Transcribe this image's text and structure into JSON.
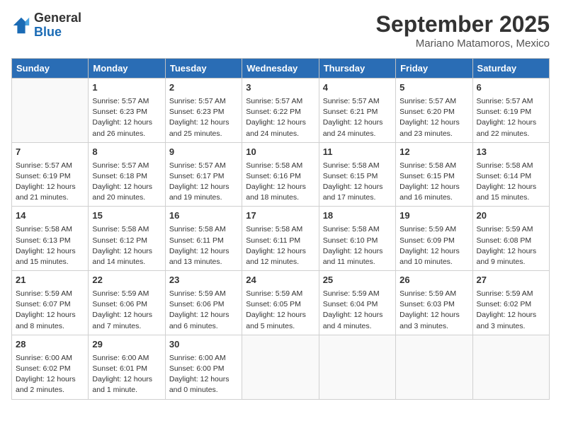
{
  "header": {
    "logo_line1": "General",
    "logo_line2": "Blue",
    "month": "September 2025",
    "location": "Mariano Matamoros, Mexico"
  },
  "days_of_week": [
    "Sunday",
    "Monday",
    "Tuesday",
    "Wednesday",
    "Thursday",
    "Friday",
    "Saturday"
  ],
  "weeks": [
    [
      {
        "num": "",
        "info": ""
      },
      {
        "num": "1",
        "info": "Sunrise: 5:57 AM\nSunset: 6:23 PM\nDaylight: 12 hours\nand 26 minutes."
      },
      {
        "num": "2",
        "info": "Sunrise: 5:57 AM\nSunset: 6:23 PM\nDaylight: 12 hours\nand 25 minutes."
      },
      {
        "num": "3",
        "info": "Sunrise: 5:57 AM\nSunset: 6:22 PM\nDaylight: 12 hours\nand 24 minutes."
      },
      {
        "num": "4",
        "info": "Sunrise: 5:57 AM\nSunset: 6:21 PM\nDaylight: 12 hours\nand 24 minutes."
      },
      {
        "num": "5",
        "info": "Sunrise: 5:57 AM\nSunset: 6:20 PM\nDaylight: 12 hours\nand 23 minutes."
      },
      {
        "num": "6",
        "info": "Sunrise: 5:57 AM\nSunset: 6:19 PM\nDaylight: 12 hours\nand 22 minutes."
      }
    ],
    [
      {
        "num": "7",
        "info": "Sunrise: 5:57 AM\nSunset: 6:19 PM\nDaylight: 12 hours\nand 21 minutes."
      },
      {
        "num": "8",
        "info": "Sunrise: 5:57 AM\nSunset: 6:18 PM\nDaylight: 12 hours\nand 20 minutes."
      },
      {
        "num": "9",
        "info": "Sunrise: 5:57 AM\nSunset: 6:17 PM\nDaylight: 12 hours\nand 19 minutes."
      },
      {
        "num": "10",
        "info": "Sunrise: 5:58 AM\nSunset: 6:16 PM\nDaylight: 12 hours\nand 18 minutes."
      },
      {
        "num": "11",
        "info": "Sunrise: 5:58 AM\nSunset: 6:15 PM\nDaylight: 12 hours\nand 17 minutes."
      },
      {
        "num": "12",
        "info": "Sunrise: 5:58 AM\nSunset: 6:15 PM\nDaylight: 12 hours\nand 16 minutes."
      },
      {
        "num": "13",
        "info": "Sunrise: 5:58 AM\nSunset: 6:14 PM\nDaylight: 12 hours\nand 15 minutes."
      }
    ],
    [
      {
        "num": "14",
        "info": "Sunrise: 5:58 AM\nSunset: 6:13 PM\nDaylight: 12 hours\nand 15 minutes."
      },
      {
        "num": "15",
        "info": "Sunrise: 5:58 AM\nSunset: 6:12 PM\nDaylight: 12 hours\nand 14 minutes."
      },
      {
        "num": "16",
        "info": "Sunrise: 5:58 AM\nSunset: 6:11 PM\nDaylight: 12 hours\nand 13 minutes."
      },
      {
        "num": "17",
        "info": "Sunrise: 5:58 AM\nSunset: 6:11 PM\nDaylight: 12 hours\nand 12 minutes."
      },
      {
        "num": "18",
        "info": "Sunrise: 5:58 AM\nSunset: 6:10 PM\nDaylight: 12 hours\nand 11 minutes."
      },
      {
        "num": "19",
        "info": "Sunrise: 5:59 AM\nSunset: 6:09 PM\nDaylight: 12 hours\nand 10 minutes."
      },
      {
        "num": "20",
        "info": "Sunrise: 5:59 AM\nSunset: 6:08 PM\nDaylight: 12 hours\nand 9 minutes."
      }
    ],
    [
      {
        "num": "21",
        "info": "Sunrise: 5:59 AM\nSunset: 6:07 PM\nDaylight: 12 hours\nand 8 minutes."
      },
      {
        "num": "22",
        "info": "Sunrise: 5:59 AM\nSunset: 6:06 PM\nDaylight: 12 hours\nand 7 minutes."
      },
      {
        "num": "23",
        "info": "Sunrise: 5:59 AM\nSunset: 6:06 PM\nDaylight: 12 hours\nand 6 minutes."
      },
      {
        "num": "24",
        "info": "Sunrise: 5:59 AM\nSunset: 6:05 PM\nDaylight: 12 hours\nand 5 minutes."
      },
      {
        "num": "25",
        "info": "Sunrise: 5:59 AM\nSunset: 6:04 PM\nDaylight: 12 hours\nand 4 minutes."
      },
      {
        "num": "26",
        "info": "Sunrise: 5:59 AM\nSunset: 6:03 PM\nDaylight: 12 hours\nand 3 minutes."
      },
      {
        "num": "27",
        "info": "Sunrise: 5:59 AM\nSunset: 6:02 PM\nDaylight: 12 hours\nand 3 minutes."
      }
    ],
    [
      {
        "num": "28",
        "info": "Sunrise: 6:00 AM\nSunset: 6:02 PM\nDaylight: 12 hours\nand 2 minutes."
      },
      {
        "num": "29",
        "info": "Sunrise: 6:00 AM\nSunset: 6:01 PM\nDaylight: 12 hours\nand 1 minute."
      },
      {
        "num": "30",
        "info": "Sunrise: 6:00 AM\nSunset: 6:00 PM\nDaylight: 12 hours\nand 0 minutes."
      },
      {
        "num": "",
        "info": ""
      },
      {
        "num": "",
        "info": ""
      },
      {
        "num": "",
        "info": ""
      },
      {
        "num": "",
        "info": ""
      }
    ]
  ]
}
